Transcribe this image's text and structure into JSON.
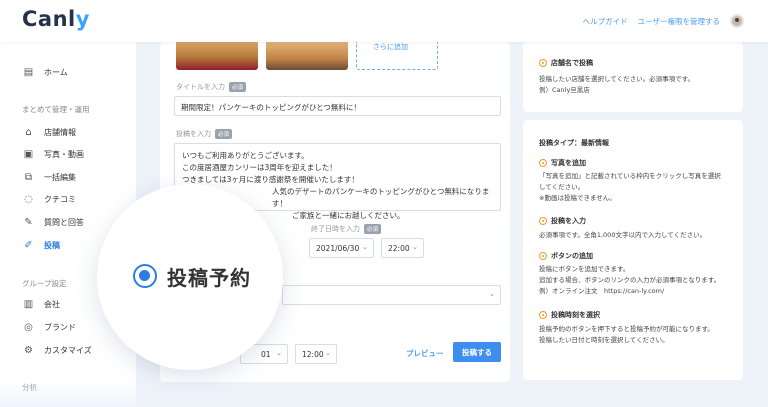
{
  "header": {
    "logo": "Canl",
    "logo_accent": "y",
    "help_link": "ヘルプガイド",
    "user_permission_link": "ユーザー権限を管理する"
  },
  "sidebar": {
    "home": "ホーム",
    "section_manage": "まとめて管理・運用",
    "items": [
      {
        "label": "店舗情報"
      },
      {
        "label": "写真・動画"
      },
      {
        "label": "一括編集"
      },
      {
        "label": "クチコミ"
      },
      {
        "label": "質問と回答"
      },
      {
        "label": "投稿"
      }
    ],
    "section_group": "グループ設定",
    "group_items": [
      {
        "label": "会社"
      },
      {
        "label": "ブランド"
      },
      {
        "label": "カスタマイズ"
      }
    ],
    "section_analysis": "分析"
  },
  "form": {
    "add_photo_label": "さらに追加",
    "title_label": "タイトルを入力",
    "required_badge": "必須",
    "title_value": "期間限定！パンケーキのトッピングがひとつ無料に！",
    "post_label": "投稿を入力",
    "post_lines": [
      "いつもご利用ありがとうございます。",
      "この度居酒屋カンリーは3周年を迎えました！",
      "つきましては3ヶ月に渡り感謝祭を開催いたします！",
      "人気のデザートのパンケーキのトッピングがひとつ無料になります！",
      "ご家族と一緒にお越しください。"
    ],
    "end_datetime_label": "終了日時を入力",
    "end_date": "2021/06/30",
    "end_time": "22:00",
    "schedule_date_partial": "01",
    "schedule_time": "12:00",
    "preview_button": "プレビュー",
    "submit_button": "投稿する"
  },
  "info_card": {
    "title": "店舗名で投稿",
    "line1": "投稿したい店舗を選択してください。必須事項です。",
    "line2": "例）Canly旦黒店"
  },
  "guide": {
    "heading": "投稿タイプ：最新情報",
    "sections": [
      {
        "title": "写真を追加",
        "lines": [
          "「写真を追加」と記載されている枠内をクリックし写真を選択",
          "してください。",
          "※動画は投稿できません。"
        ]
      },
      {
        "title": "投稿を入力",
        "lines": [
          "必須事項です。全角1,000文字以内で入力してください。"
        ]
      },
      {
        "title": "ボタンの追加",
        "lines": [
          "投稿にボタンを追加できます。",
          "追加する場合、ボタンのリンクの入力が必須事項となります。",
          "例）オンライン注文　https://can-ly.com/"
        ]
      },
      {
        "title": "投稿時刻を選択",
        "lines": [
          "投稿予約のボタンを押下すると投稿予約が可能になります。",
          "投稿したい日付と時刻を選択してください。"
        ]
      }
    ]
  },
  "magnifier": {
    "label": "投稿予約"
  },
  "colors": {
    "accent": "#3d8ef0",
    "pin": "#f29a2e",
    "background": "#eef3fa"
  }
}
